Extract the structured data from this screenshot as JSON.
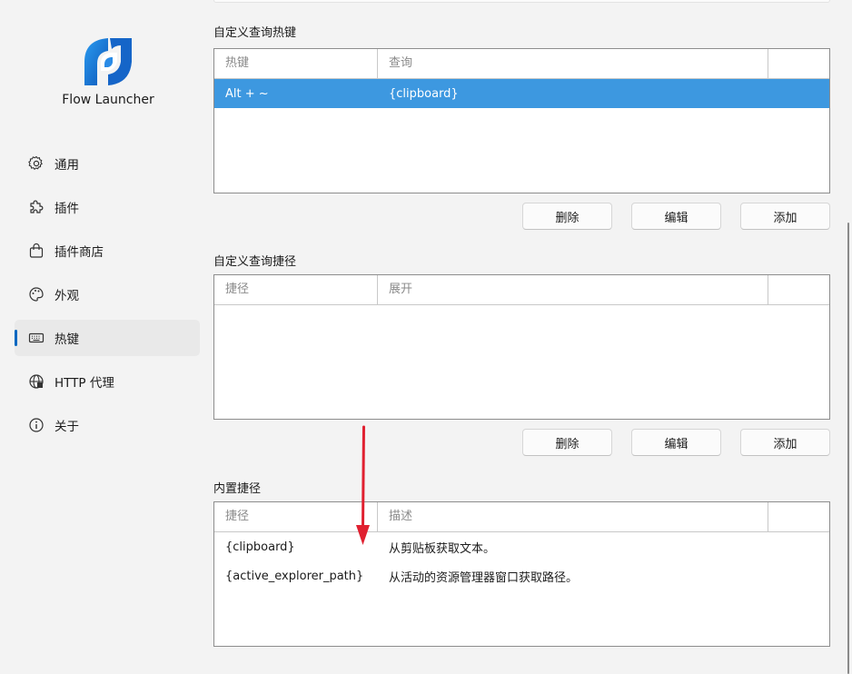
{
  "app": {
    "name": "Flow Launcher"
  },
  "sidebar": {
    "items": [
      {
        "label": "通用",
        "icon": "gear-icon"
      },
      {
        "label": "插件",
        "icon": "puzzle-icon"
      },
      {
        "label": "插件商店",
        "icon": "shopping-bag-icon"
      },
      {
        "label": "外观",
        "icon": "palette-icon"
      },
      {
        "label": "热键",
        "icon": "keyboard-icon",
        "active": true
      },
      {
        "label": "HTTP 代理",
        "icon": "globe-icon"
      },
      {
        "label": "关于",
        "icon": "info-icon"
      }
    ]
  },
  "hotkeys": {
    "title": "自定义查询热键",
    "headers": [
      "热键",
      "查询"
    ],
    "rows": [
      {
        "hotkey": "Alt + ~",
        "query": "{clipboard}",
        "selected": true
      }
    ]
  },
  "shortcuts": {
    "title": "自定义查询捷径",
    "headers": [
      "捷径",
      "展开"
    ],
    "rows": []
  },
  "builtin": {
    "title": "内置捷径",
    "headers": [
      "捷径",
      "描述"
    ],
    "rows": [
      {
        "shortcut": "{clipboard}",
        "description": "从剪贴板获取文本。"
      },
      {
        "shortcut": "{active_explorer_path}",
        "description": "从活动的资源管理器窗口获取路径。"
      }
    ]
  },
  "buttons": {
    "delete": "删除",
    "edit": "编辑",
    "add": "添加"
  },
  "colors": {
    "accent": "#0067c0",
    "selection": "#3d98e0",
    "annotation_arrow": "#e02030"
  }
}
